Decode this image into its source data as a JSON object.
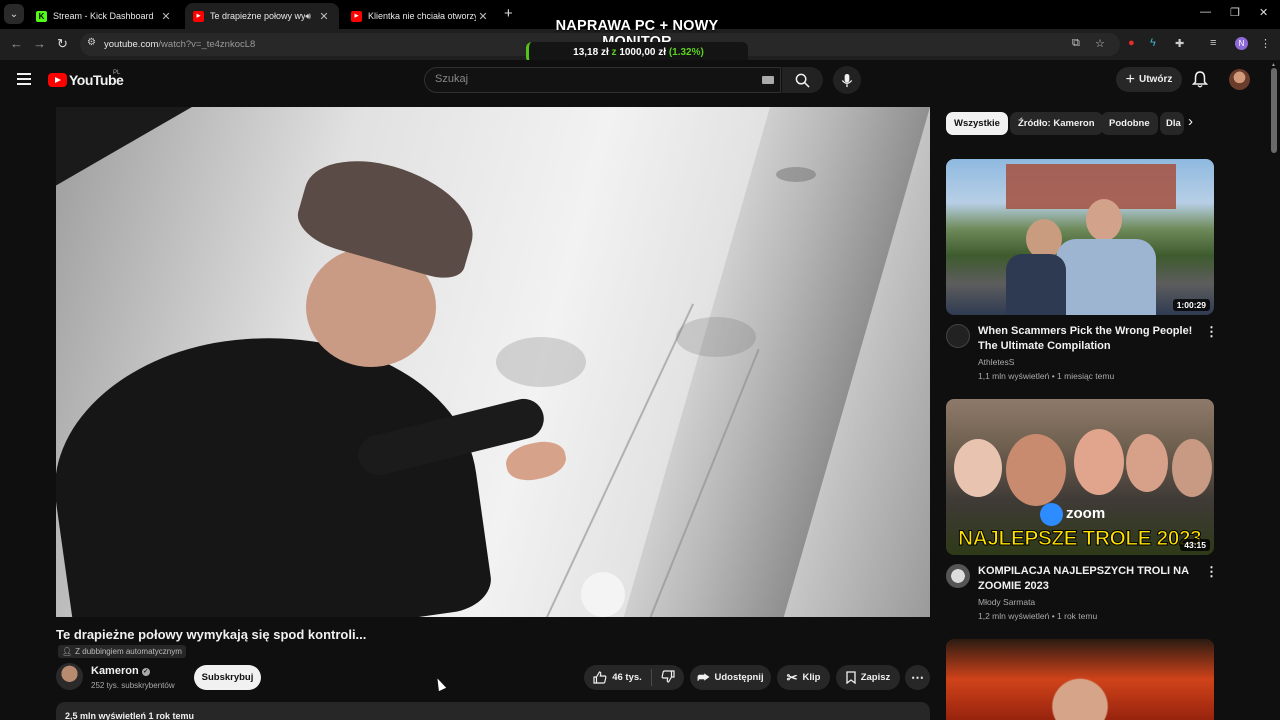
{
  "browser": {
    "tabs": [
      {
        "title": "Stream - Kick Dashboard"
      },
      {
        "title": "Te drapieżne połowy wymyk"
      },
      {
        "title": "Klientka nie chciała otworzyć m"
      }
    ],
    "url_main": "youtube.com",
    "url_path": "/watch?v=_te4znkocL8",
    "profile_initial": "N"
  },
  "overlay": {
    "title": "NAPRAWA PC + NOWY MONITOR",
    "raised": "13,18 zł",
    "of": "z",
    "goal": "1000,00 zł",
    "percent": "(1.32%)",
    "progress_fraction": 0.0132
  },
  "youtube": {
    "logo_text": "YouTube",
    "country_code": "PL",
    "search_placeholder": "Szukaj",
    "create_label": "Utwórz"
  },
  "video": {
    "title": "Te drapieżne połowy wymykają się spod kontroli...",
    "dubbing": "Z dubbingiem automatycznym",
    "channel": "Kameron",
    "subscribers": "252 tys. subskrybentów",
    "subscribe_label": "Subskrybuj",
    "likes": "46 tys.",
    "share_label": "Udostępnij",
    "clip_label": "Klip",
    "save_label": "Zapisz",
    "desc_stats": "2,5 mln wyświetleń  1 rok temu"
  },
  "chips": [
    {
      "label": "Wszystkie"
    },
    {
      "label": "Źródło: Kameron"
    },
    {
      "label": "Podobne"
    },
    {
      "label": "Dla"
    }
  ],
  "recommendations": [
    {
      "title": "When Scammers Pick the Wrong People! The Ultimate Compilation",
      "channel": "AthletesS",
      "meta": "1,1 mln wyświetleń • 1 miesiąc temu",
      "duration": "1:00:29"
    },
    {
      "title": "KOMPILACJA NAJLEPSZYCH TROLI NA ZOOMIE 2023",
      "channel": "Młody Sarmata",
      "meta": "1,2 mln wyświetleń • 1 rok temu",
      "duration": "43:15",
      "thumb_word": "zoom",
      "thumb_caption": "NAJLEPSZE TROLE 2023"
    }
  ],
  "colors": {
    "youtube_red": "#ff0000",
    "kick_green": "#53fc18",
    "page_bg": "#0f0f0f"
  }
}
